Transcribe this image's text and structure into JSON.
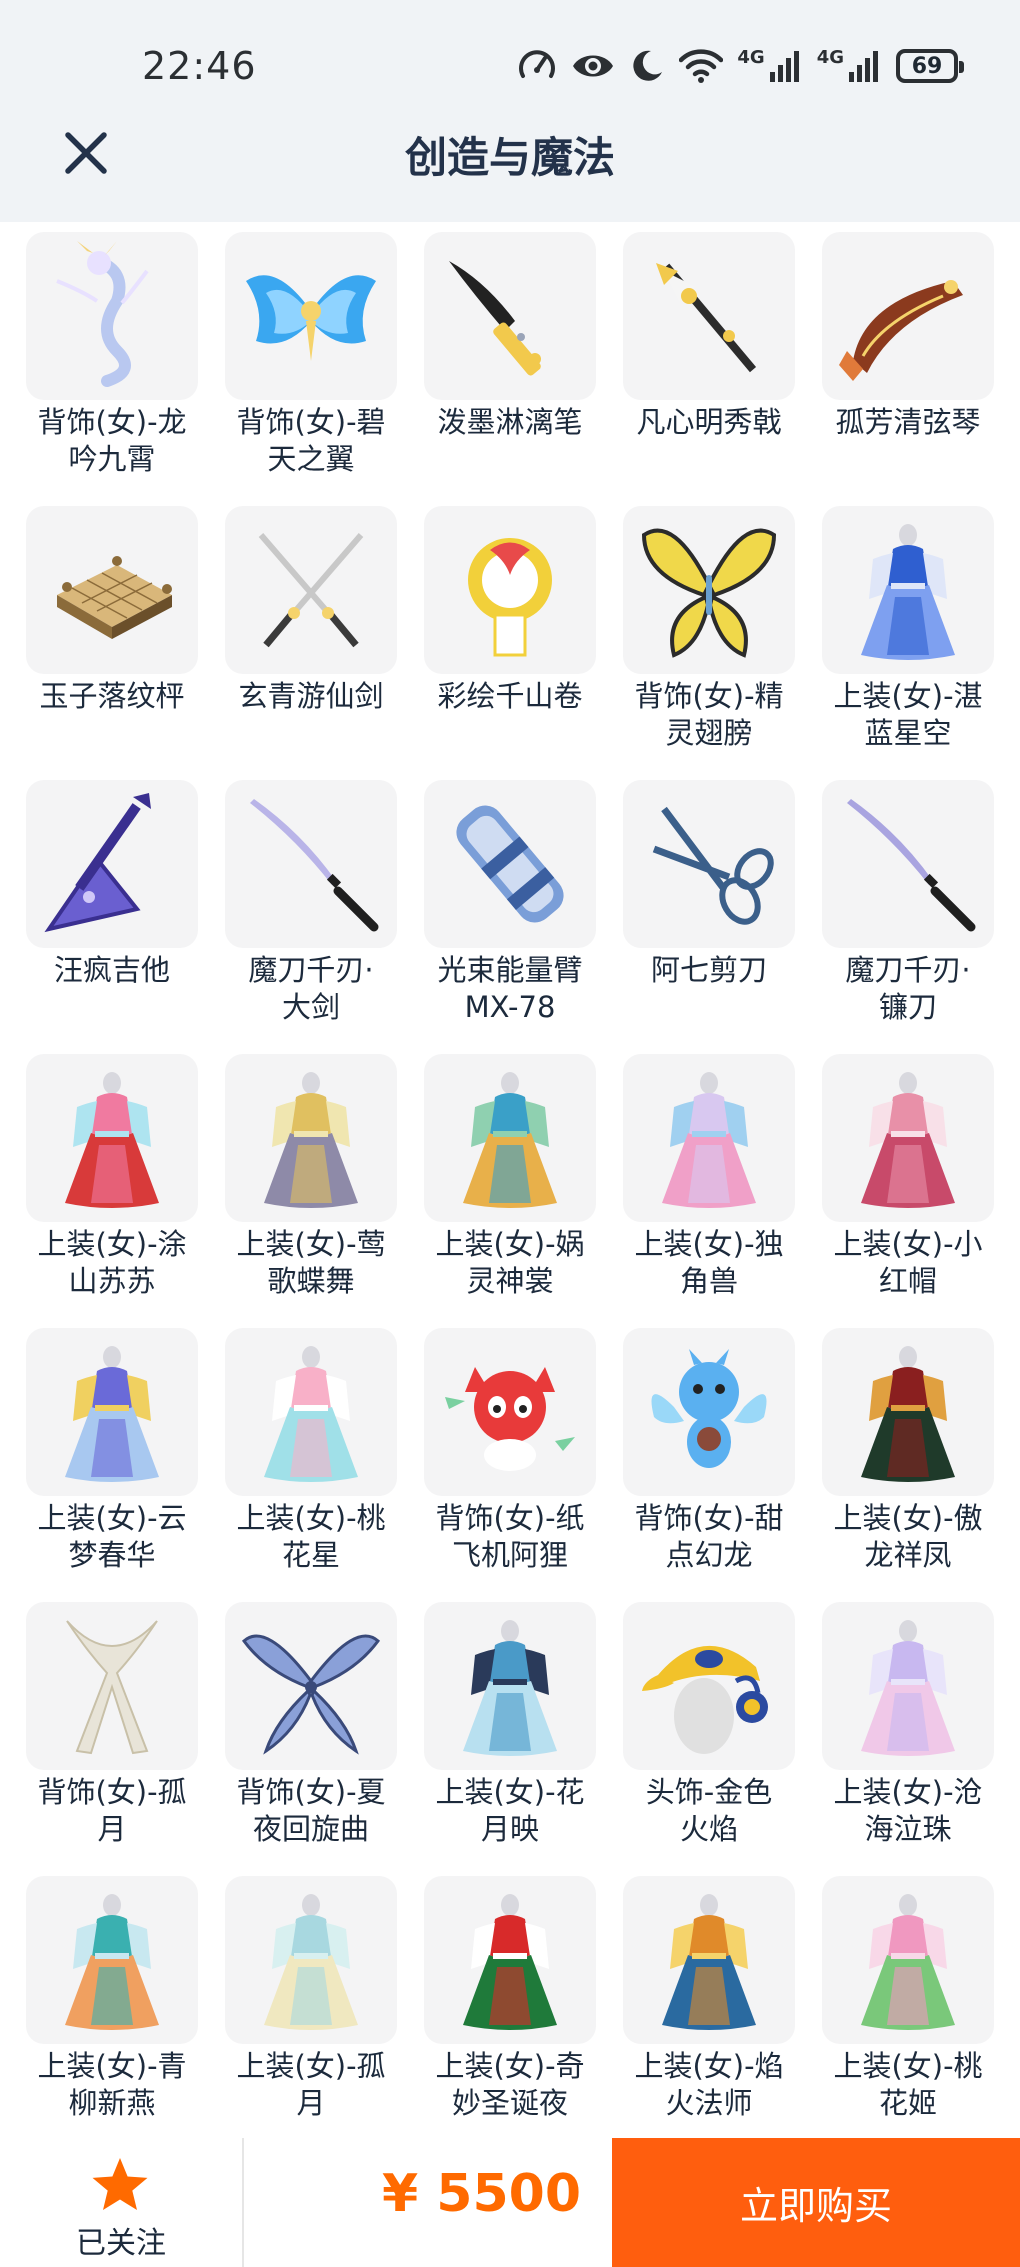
{
  "status_bar": {
    "time": "22:46",
    "network_label_1": "4G",
    "network_label_2": "4G",
    "battery": "69"
  },
  "header": {
    "title": "创造与魔法",
    "close_icon": "close-icon"
  },
  "items": [
    {
      "name": "背饰(女)-龙\n吟九霄",
      "icon": "dragon",
      "colors": [
        "#b9c8f0",
        "#e8e1ff",
        "#f3d37a"
      ]
    },
    {
      "name": "背饰(女)-碧\n天之翼",
      "icon": "wings",
      "colors": [
        "#3aa7f0",
        "#8fd3ff",
        "#f5d36b"
      ]
    },
    {
      "name": "泼墨淋漓笔",
      "icon": "brush",
      "colors": [
        "#222222",
        "#f2c94c",
        "#9aa4b8"
      ]
    },
    {
      "name": "凡心明秀戟",
      "icon": "halberd",
      "colors": [
        "#2c2c2c",
        "#f2c94c",
        "#f5f5f5"
      ]
    },
    {
      "name": "孤芳清弦琴",
      "icon": "lute",
      "colors": [
        "#8b3a1e",
        "#e07a3a",
        "#f5d36b"
      ]
    },
    {
      "name": "玉子落纹枰",
      "icon": "board",
      "colors": [
        "#d9b77a",
        "#f5d36b",
        "#8b6b3a"
      ]
    },
    {
      "name": "玄青游仙剑",
      "icon": "swords",
      "colors": [
        "#c8c8c8",
        "#3a3a3a",
        "#f5d36b"
      ]
    },
    {
      "name": "彩绘千山卷",
      "icon": "scroll",
      "colors": [
        "#f2d03a",
        "#e84a4a",
        "#ffffff"
      ]
    },
    {
      "name": "背饰(女)-精\n灵翅膀",
      "icon": "butterfly",
      "colors": [
        "#f0d84a",
        "#2b2b2b",
        "#6aa0d0"
      ]
    },
    {
      "name": "上装(女)-湛\n蓝星空",
      "icon": "dress",
      "colors": [
        "#2f5fd0",
        "#7ea0f0",
        "#dfe6f8"
      ]
    },
    {
      "name": "汪疯吉他",
      "icon": "guitar",
      "colors": [
        "#6a5fd0",
        "#3a2f90",
        "#d0c8f8"
      ]
    },
    {
      "name": "魔刀千刃·\n大剑",
      "icon": "katana",
      "colors": [
        "#b9b4e8",
        "#1f1f1f",
        "#d0cdf5"
      ]
    },
    {
      "name": "光束能量臂\nMX-78",
      "icon": "arm",
      "colors": [
        "#7a9ed8",
        "#3b5fa0",
        "#cfdcf2"
      ]
    },
    {
      "name": "阿七剪刀",
      "icon": "scissors",
      "colors": [
        "#3b5f8a",
        "#7a9ed8",
        "#dfe6f0"
      ]
    },
    {
      "name": "魔刀千刃·\n镰刀",
      "icon": "katana",
      "colors": [
        "#a9a4e0",
        "#1f1f1f",
        "#d0cdf5"
      ]
    },
    {
      "name": "上装(女)-涂\n山苏苏",
      "icon": "dress",
      "colors": [
        "#f07aa0",
        "#d83a3a",
        "#aee4f0"
      ]
    },
    {
      "name": "上装(女)-莺\n歌蝶舞",
      "icon": "dress",
      "colors": [
        "#e0c060",
        "#8e8aa8",
        "#f0e6b0"
      ]
    },
    {
      "name": "上装(女)-娲\n灵神裳",
      "icon": "dress",
      "colors": [
        "#3aa0c8",
        "#e8b04a",
        "#8fd0b0"
      ]
    },
    {
      "name": "上装(女)-独\n角兽",
      "icon": "dress",
      "colors": [
        "#d8c8f0",
        "#f0a0c8",
        "#a0d0f0"
      ]
    },
    {
      "name": "上装(女)-小\n红帽",
      "icon": "dress",
      "colors": [
        "#e890a8",
        "#c84a6a",
        "#f8e0e8"
      ]
    },
    {
      "name": "上装(女)-云\n梦春华",
      "icon": "dress",
      "colors": [
        "#6a6ad8",
        "#a8c8f0",
        "#f0d060"
      ]
    },
    {
      "name": "上装(女)-桃\n花星",
      "icon": "dress",
      "colors": [
        "#f8b0c8",
        "#a0e0e8",
        "#ffffff"
      ]
    },
    {
      "name": "背饰(女)-纸\n飞机阿狸",
      "icon": "fox",
      "colors": [
        "#e83a3a",
        "#ffffff",
        "#7ad0a0"
      ]
    },
    {
      "name": "背饰(女)-甜\n点幻龙",
      "icon": "pet-dragon",
      "colors": [
        "#5ab0f0",
        "#8a4a3a",
        "#9ad8f8"
      ]
    },
    {
      "name": "上装(女)-傲\n龙祥凤",
      "icon": "dress",
      "colors": [
        "#8a1f1f",
        "#1f3a2a",
        "#e0a040"
      ]
    },
    {
      "name": "背饰(女)-孤\n月",
      "icon": "ribbon",
      "colors": [
        "#e8e4d8",
        "#c8c0a8",
        "#f5f2ea"
      ]
    },
    {
      "name": "背饰(女)-夏\n夜回旋曲",
      "icon": "fairy-wings",
      "colors": [
        "#3a4a7a",
        "#8aa0d8",
        "#c8d4f0"
      ]
    },
    {
      "name": "上装(女)-花\n月映",
      "icon": "dress",
      "colors": [
        "#4a9ac8",
        "#b8e0f0",
        "#2a3a5a"
      ]
    },
    {
      "name": "头饰-金色\n火焰",
      "icon": "cap",
      "colors": [
        "#f2c22a",
        "#2b4aa0",
        "#e0e0e0"
      ]
    },
    {
      "name": "上装(女)-沧\n海泣珠",
      "icon": "dress",
      "colors": [
        "#c8b8f0",
        "#f0c8e8",
        "#e8e4fa"
      ]
    },
    {
      "name": "上装(女)-青\n柳新燕",
      "icon": "dress",
      "colors": [
        "#3ab0b0",
        "#f0a060",
        "#c8e8f0"
      ]
    },
    {
      "name": "上装(女)-孤\n月",
      "icon": "dress",
      "colors": [
        "#a8d8e0",
        "#f0e8c0",
        "#d8f0f0"
      ]
    },
    {
      "name": "上装(女)-奇\n妙圣诞夜",
      "icon": "dress",
      "colors": [
        "#d82a2a",
        "#1f7a3a",
        "#ffffff"
      ]
    },
    {
      "name": "上装(女)-焰\n火法师",
      "icon": "dress",
      "colors": [
        "#e08a2a",
        "#2a6aa0",
        "#f5d36b"
      ]
    },
    {
      "name": "上装(女)-桃\n花姬",
      "icon": "dress",
      "colors": [
        "#f098c0",
        "#7ac87a",
        "#f8d8e8"
      ]
    }
  ],
  "bottom_bar": {
    "follow_label": "已关注",
    "price": "¥ 5500",
    "buy_label": "立即购买"
  },
  "colors": {
    "accent": "#ff5e0e",
    "price": "#ff6a00",
    "star": "#ff6a00",
    "header_bg": "#f0f3f6"
  }
}
